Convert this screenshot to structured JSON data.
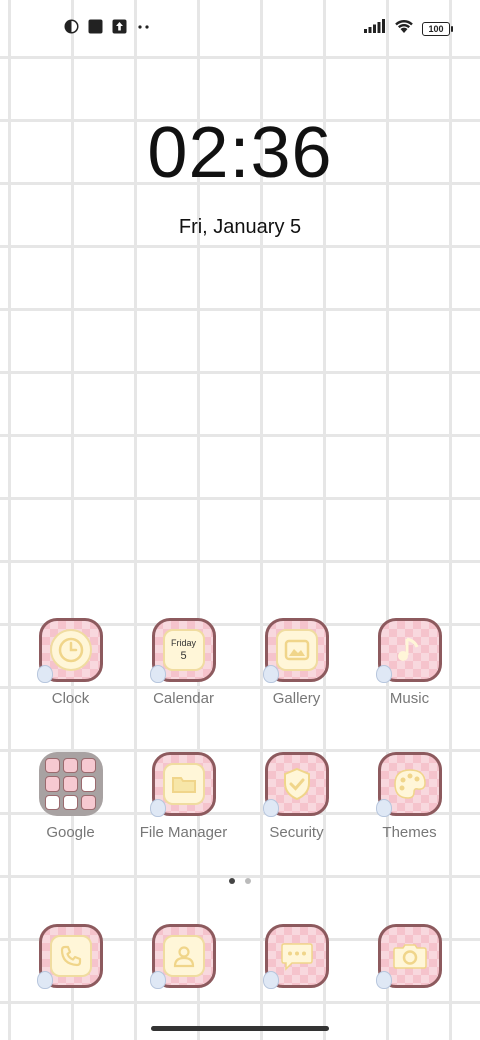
{
  "status_bar": {
    "left_icons": [
      "weather-icon",
      "square-icon",
      "upload-icon",
      "more-dots-icon"
    ],
    "battery": "100"
  },
  "lockscreen": {
    "time": "02:36",
    "date": "Fri, January 5"
  },
  "apps": [
    {
      "label": "Clock"
    },
    {
      "label": "Calendar",
      "day": "Friday",
      "date_num": "5"
    },
    {
      "label": "Gallery"
    },
    {
      "label": "Music"
    },
    {
      "label": "Google"
    },
    {
      "label": "File Manager"
    },
    {
      "label": "Security"
    },
    {
      "label": "Themes"
    }
  ],
  "dock": [
    "phone-icon",
    "contacts-icon",
    "messages-icon",
    "camera-icon"
  ],
  "page_indicator": {
    "pages": 2,
    "current": 1
  },
  "colors": {
    "icon_bg": "#f5c3cc",
    "icon_border": "#8d5a5e",
    "inner": "#fff6d8"
  }
}
